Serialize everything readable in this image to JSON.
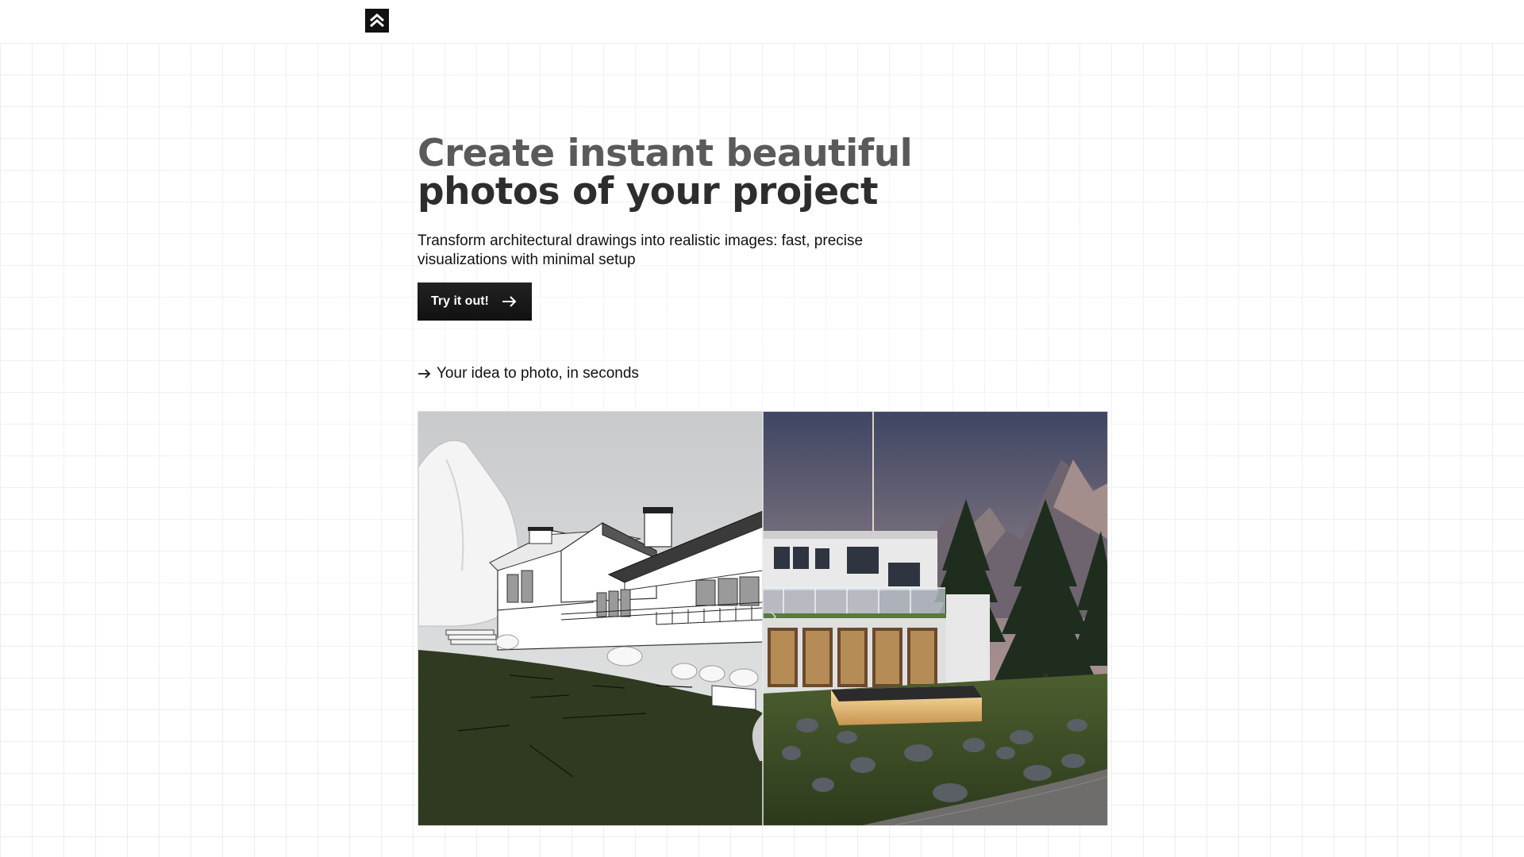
{
  "header": {
    "logo_icon": "double-chevron-up-icon"
  },
  "hero": {
    "title_line1": "Create instant beautiful",
    "title_line2": "photos of your project",
    "subtitle": "Transform architectural drawings into realistic images: fast, precise visualizations with minimal setup",
    "cta_label": "Try it out!",
    "cta_icon": "arrow-right-icon"
  },
  "section": {
    "tagline_icon": "arrow-right-icon",
    "tagline": "Your idea to photo, in seconds"
  },
  "comparison": {
    "left_image": "sketch-render",
    "right_image": "photo-render",
    "handle_icon": "chevron-right-icon",
    "divider_position": 0.5
  }
}
